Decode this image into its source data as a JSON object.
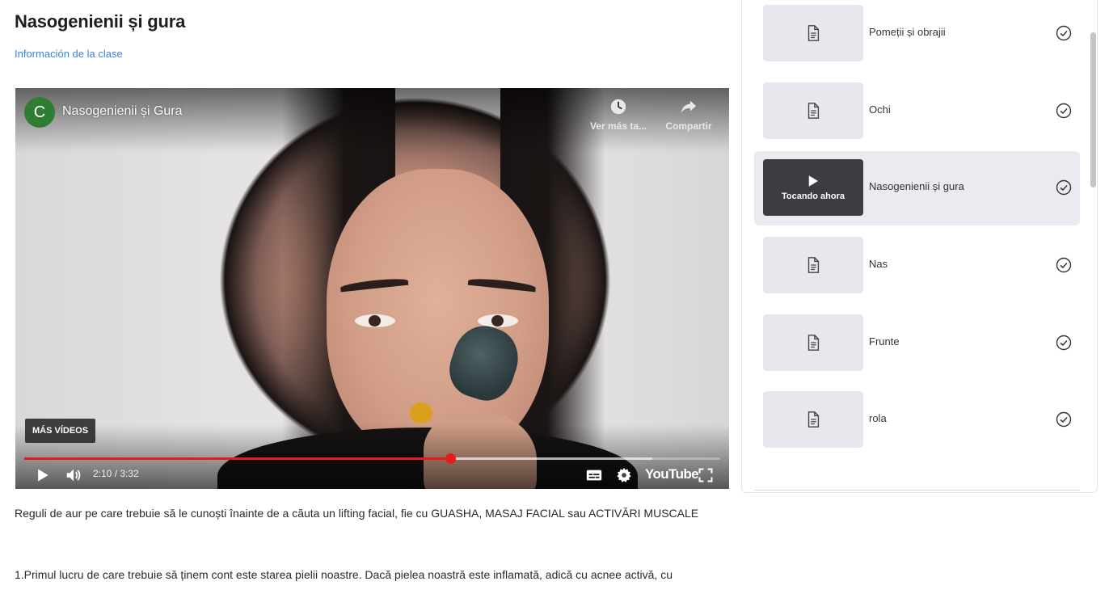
{
  "lesson": {
    "title": "Nasogenienii și gura",
    "class_info_link": "Información de la clase"
  },
  "video": {
    "channel_initial": "C",
    "title": "Nasogenienii și Gura",
    "watch_later_label": "Ver más ta...",
    "share_label": "Compartir",
    "more_videos_label": "MÁS VÍDEOS",
    "time_display": "2:10 / 3:32",
    "played_fraction": 0.612,
    "buffered_fraction": 0.903,
    "logo_text": "YouTube",
    "icons": [
      "play-icon",
      "volume-icon",
      "subtitles-icon",
      "settings-icon",
      "fullscreen-icon",
      "clock-icon",
      "share-icon"
    ]
  },
  "content": {
    "paragraph_1": "Reguli de aur pe care trebuie să le cunoști înainte de a căuta un lifting facial, fie cu GUASHA, MASAJ FACIAL sau ACTIVĂRI MUSCALE",
    "paragraph_2": "1.Primul lucru de care trebuie să ținem cont este starea pielii noastre. Dacă pielea noastră este inflamată, adică cu acnee activă, cu"
  },
  "sidebar": {
    "now_playing_label": "Tocando ahora",
    "items": [
      {
        "label": "Pomeții și obrajii",
        "completed": true,
        "active": false
      },
      {
        "label": "Ochi",
        "completed": true,
        "active": false
      },
      {
        "label": "Nasogenienii și gura",
        "completed": true,
        "active": true
      },
      {
        "label": "Nas",
        "completed": true,
        "active": false
      },
      {
        "label": "Frunte",
        "completed": true,
        "active": false
      },
      {
        "label": "rola",
        "completed": true,
        "active": false
      }
    ]
  },
  "colors": {
    "link": "#3b82e0",
    "progress": "#e51c1c",
    "active_item_bg": "#e9ebf0",
    "thumb_bg": "#e6e8ee",
    "channel_avatar": "#2e7d32"
  }
}
